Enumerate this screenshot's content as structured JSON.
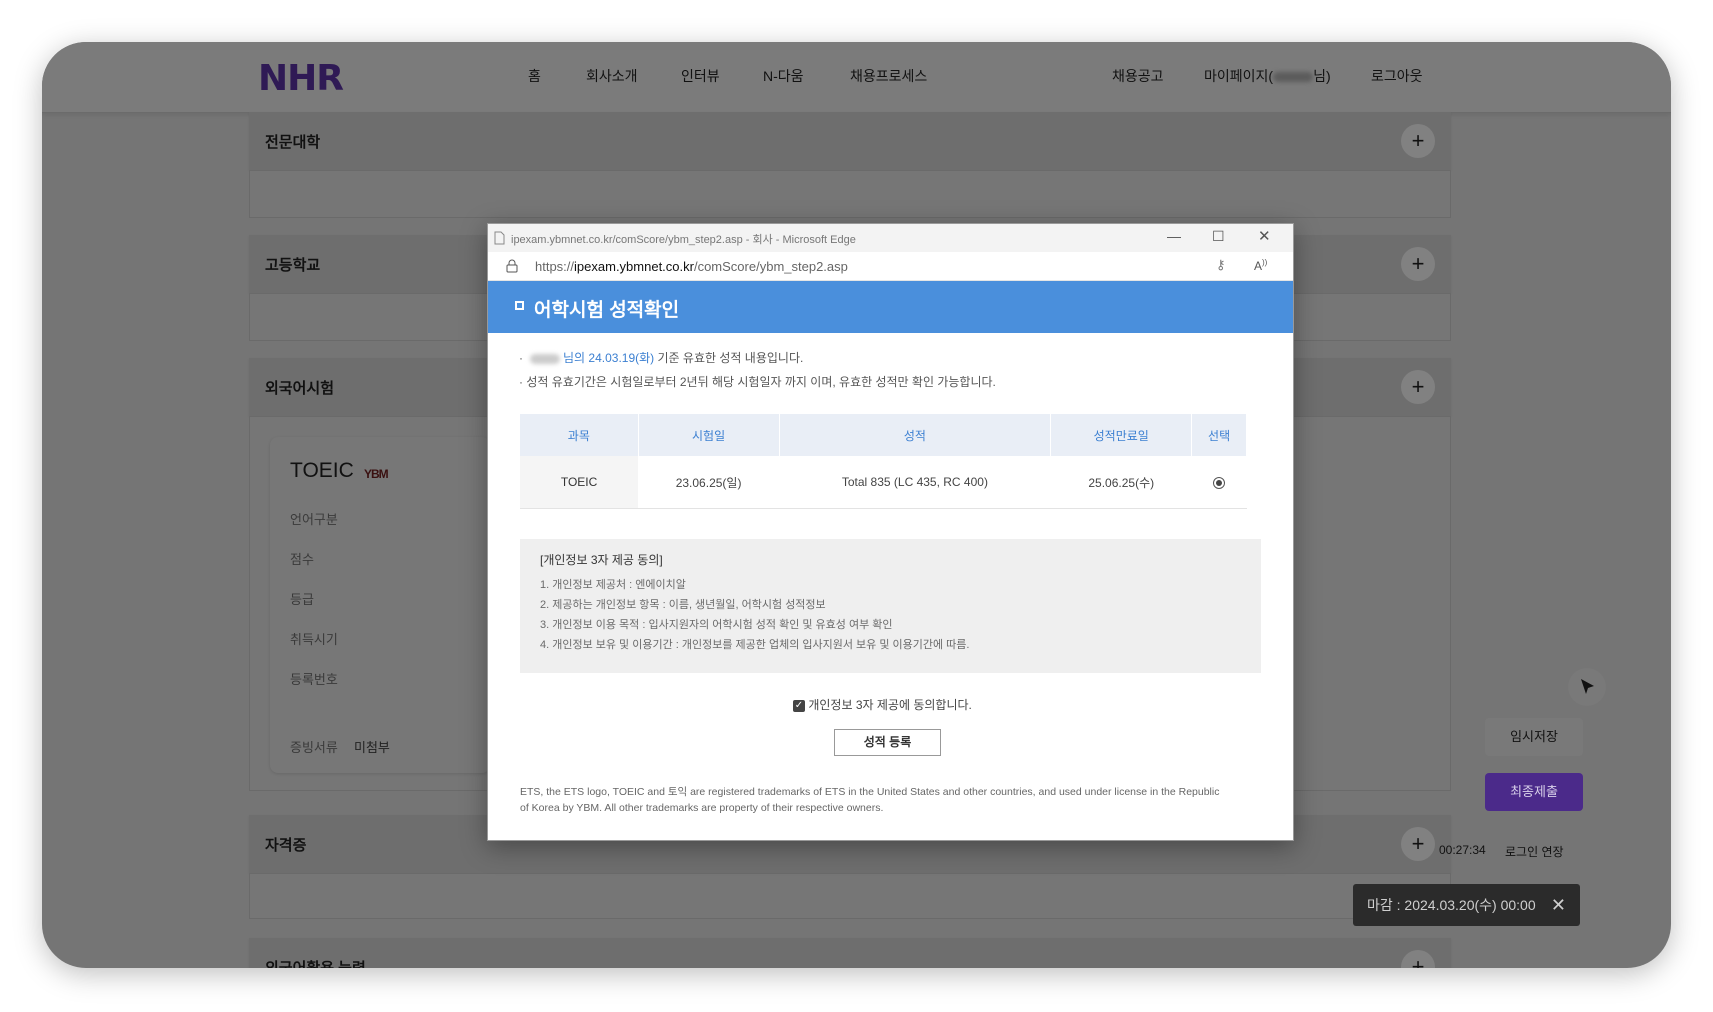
{
  "site": {
    "logo": "NHR",
    "nav": [
      "홈",
      "회사소개",
      "인터뷰",
      "N-다움",
      "채용프로세스"
    ],
    "nav_right": {
      "jobs": "채용공고",
      "mypage_prefix": "마이페이지(",
      "mypage_suffix": "님)",
      "logout": "로그아웃"
    }
  },
  "sections": {
    "college": "전문대학",
    "highschool": "고등학교",
    "foreign_exam": "외국어시험",
    "certificate": "자격증",
    "foreign_ability": "외국어활용 능력"
  },
  "toeic_card": {
    "title": "TOEIC",
    "logo_text": "YBM",
    "fields": [
      "언어구분",
      "점수",
      "등급",
      "취득시기",
      "등록번호"
    ],
    "proof_label": "증빙서류",
    "proof_value": "미첨부"
  },
  "side": {
    "temp_save": "임시저장",
    "final_submit": "최종제출",
    "timer": "00:27:34",
    "extend_login": "로그인 연장",
    "deadline": "마감 : 2024.03.20(수) 00:00",
    "colors": {
      "submit": "#4b2a8a",
      "deadline_bg": "#2b2b2b"
    }
  },
  "popup": {
    "window_title": "ipexam.ybmnet.co.kr/comScore/ybm_step2.asp - 회사 - Microsoft Edge",
    "url_prefix": "https://",
    "url_host": "ipexam.ybmnet.co.kr",
    "url_path": "/comScore/ybm_step2.asp",
    "header": "어학시험 성적확인",
    "notice1_blue": "님의 24.03.19(화)",
    "notice1_rest": " 기준 유효한 성적 내용입니다.",
    "notice2": "성적 유효기간은 시험일로부터 2년뒤 해당 시험일자 까지 이며, 유효한 성적만 확인 가능합니다.",
    "table": {
      "headers": [
        "과목",
        "시험일",
        "성적",
        "성적만료일",
        "선택"
      ],
      "rows": [
        {
          "subject": "TOEIC",
          "date": "23.06.25(일)",
          "score": "Total 835 (LC 435, RC 400)",
          "expiry": "25.06.25(수)"
        }
      ]
    },
    "privacy": {
      "title": "[개인정보 3자 제공 동의]",
      "lines": [
        "1. 개인정보 제공처 : 엔에이치알",
        "2. 제공하는 개인정보 항목 : 이름, 생년월일, 어학시험 성적정보",
        "3. 개인정보 이용 목적 : 입사지원자의 어학시험 성적 확인 및 유효성 여부 확인",
        "4. 개인정보 보유 및 이용기간 : 개인정보를 제공한 업체의 입사지원서 보유 및 이용기간에 따름."
      ]
    },
    "agree_label": "개인정보 3자 제공에 동의합니다.",
    "register_button": "성적 등록",
    "footer": "ETS, the ETS logo, TOEIC and 토익 are registered trademarks of ETS in the United States and other countries, and used under license in the Republic of Korea by YBM. All other trademarks are property of their respective owners.",
    "colors": {
      "header": "#4a8fdc",
      "accent_text": "#3b7fd1"
    }
  }
}
